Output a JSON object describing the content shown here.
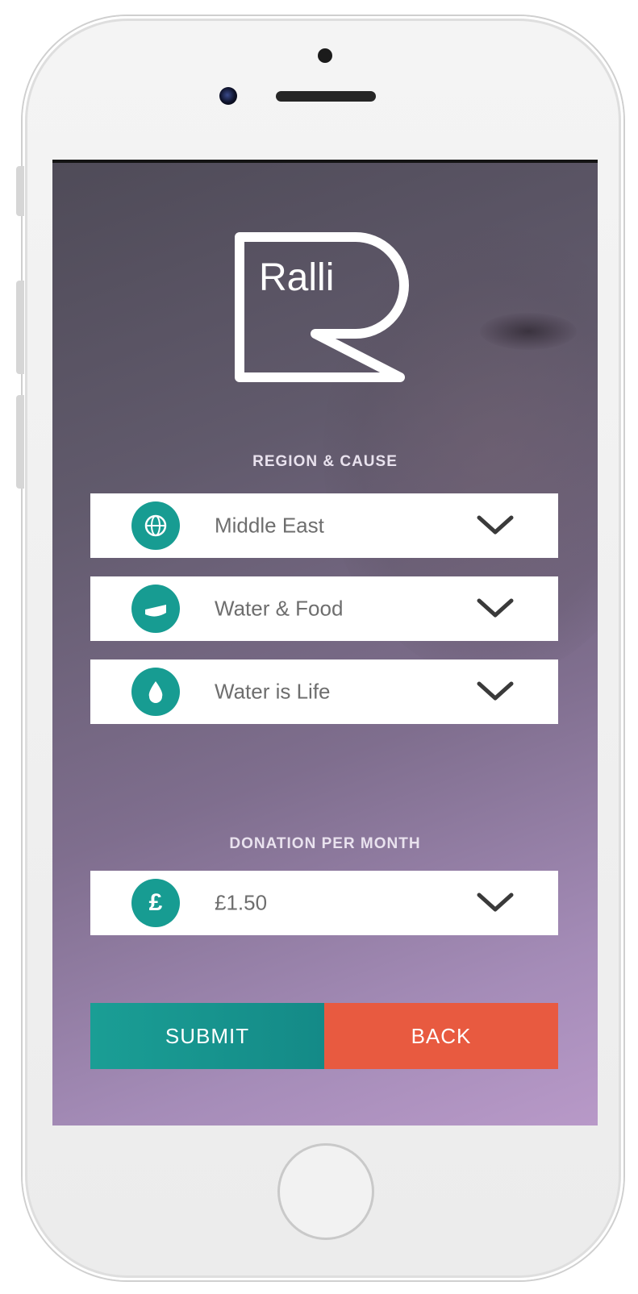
{
  "app": {
    "logo_text": "Ralli"
  },
  "form": {
    "region_cause_label": "REGION & CAUSE",
    "region": {
      "value": "Middle East",
      "icon": "globe-icon"
    },
    "cause": {
      "value": "Water & Food",
      "icon": "food-icon"
    },
    "project": {
      "value": "Water is Life",
      "icon": "water-drop-icon"
    },
    "donation_label": "DONATION PER MONTH",
    "donation": {
      "value": "£1.50",
      "icon": "pound-icon",
      "icon_glyph": "£"
    }
  },
  "actions": {
    "submit_label": "SUBMIT",
    "back_label": "BACK"
  },
  "colors": {
    "accent_teal": "#179c92",
    "back_orange": "#e85a40",
    "background_purple": "#a58cb8"
  }
}
